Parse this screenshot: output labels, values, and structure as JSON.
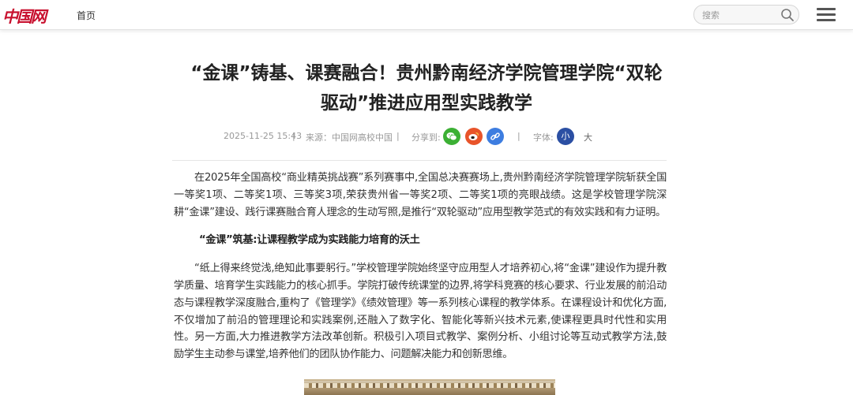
{
  "header": {
    "logo_text": "中国网",
    "nav_home": "首页",
    "search_placeholder": "搜索"
  },
  "article": {
    "title": "“金课”铸基、课赛融合！贵州黔南经济学院管理学院“双轮驱动”推进应用型实践教学",
    "meta": {
      "date": "2025-11-25 15:43",
      "source": "来源：中国网高校中国",
      "share_label": "分享到:",
      "font_label": "字体:",
      "font_small": "小",
      "font_big": "大"
    },
    "paragraphs": [
      "在2025年全国高校“商业精英挑战赛”系列赛事中,全国总决赛赛场上,贵州黔南经济学院管理学院斩获全国一等奖1项、二等奖1项、三等奖3项,荣获贵州省一等奖2项、二等奖1项的亮眼战绩。这是学校管理学院深耕“金课”建设、践行课赛融合育人理念的生动写照,是推行“双轮驱动”应用型教学范式的有效实践和有力证明。",
      "“纸上得来终觉浅,绝知此事要躬行。”学校管理学院始终坚守应用型人才培养初心,将“金课”建设作为提升教学质量、培育学生实践能力的核心抓手。学院打破传统课堂的边界,将学科竞赛的核心要求、行业发展的前沿动态与课程教学深度融合,重构了《管理学》《绩效管理》等一系列核心课程的教学体系。在课程设计和优化方面,不仅增加了前沿的管理理论和实践案例,还融入了数字化、智能化等新兴技术元素,使课程更具时代性和实用性。另一方面,大力推进教学方法改革创新。积极引入项目式教学、案例分析、小组讨论等互动式教学方法,鼓励学生主动参与课堂,培养他们的团队协作能力、问题解决能力和创新思维。"
    ],
    "subheading": "“金课”筑基:让课程教学成为实践能力培育的沃土"
  },
  "colors": {
    "brand_red": "#c8102e",
    "wechat_green": "#3cb034",
    "weibo_orange": "#e8542a",
    "link_blue": "#3d7de0",
    "font_active_blue": "#2b4fa3"
  }
}
